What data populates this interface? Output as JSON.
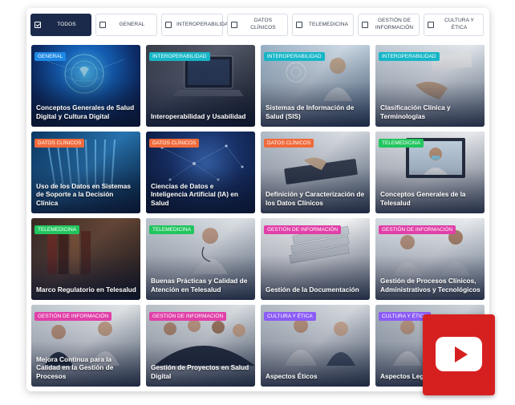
{
  "filters": [
    {
      "label": "TODOS",
      "active": true
    },
    {
      "label": "GENERAL",
      "active": false
    },
    {
      "label": "INTEROPERABILIDAD",
      "active": false
    },
    {
      "label": "DATOS CLÍNICOS",
      "active": false
    },
    {
      "label": "TELEMEDICINA",
      "active": false
    },
    {
      "label": "GESTIÓN DE INFORMACIÓN",
      "active": false
    },
    {
      "label": "CULTURA Y ÉTICA",
      "active": false
    }
  ],
  "cards": [
    {
      "tag": "GENERAL",
      "title": "Conceptos Generales de Salud Digital y Cultura Digital"
    },
    {
      "tag": "INTEROPERABILIDAD",
      "title": "Interoperabilidad y Usabilidad"
    },
    {
      "tag": "INTEROPERABILIDAD",
      "title": "Sistemas de Información de Salud (SIS)"
    },
    {
      "tag": "INTEROPERABILIDAD",
      "title": "Clasificación Clínica y Terminologías"
    },
    {
      "tag": "DATOS CLÍNICOS",
      "title": "Uso de los Datos en Sistemas de Soporte a la Decisión Clínica"
    },
    {
      "tag": "DATOS CLÍNICOS",
      "title": "Ciencias de Datos e Inteligencia Artificial (IA) en Salud"
    },
    {
      "tag": "DATOS CLÍNICOS",
      "title": "Definición y Caracterización de los Datos Clínicos"
    },
    {
      "tag": "TELEMEDICINA",
      "title": "Conceptos Generales de la Telesalud"
    },
    {
      "tag": "TELEMEDICINA",
      "title": "Marco Regulatorio en Telesalud"
    },
    {
      "tag": "TELEMEDICINA",
      "title": "Buenas Prácticas y Calidad de Atención en Telesalud"
    },
    {
      "tag": "GESTIÓN DE INFORMACIÓN",
      "title": "Gestión de la Documentación"
    },
    {
      "tag": "GESTIÓN DE INFORMACIÓN",
      "title": "Gestión de Procesos Clínicos, Administrativos y Tecnológicos"
    },
    {
      "tag": "GESTIÓN DE INFORMACIÓN",
      "title": "Mejora Continua para la Calidad en la Gestión de Procesos"
    },
    {
      "tag": "GESTIÓN DE INFORMACIÓN",
      "title": "Gestión de Proyectos en Salud Digital"
    },
    {
      "tag": "CULTURA Y ÉTICA",
      "title": "Aspectos Éticos"
    },
    {
      "tag": "CULTURA Y ÉTICA",
      "title": "Aspectos Legales"
    }
  ],
  "colors": {
    "general": "#1e88e5",
    "interoperabilidad": "#17b6c7",
    "datos": "#f06a3b",
    "telemedicina": "#22c55e",
    "gestion": "#e040a8",
    "cultura": "#8b5cf6",
    "play": "#d62020",
    "active_filter": "#1b2a4a"
  },
  "icons": {
    "filter_checkbox": "checkbox-icon",
    "video": "youtube-play-icon"
  }
}
